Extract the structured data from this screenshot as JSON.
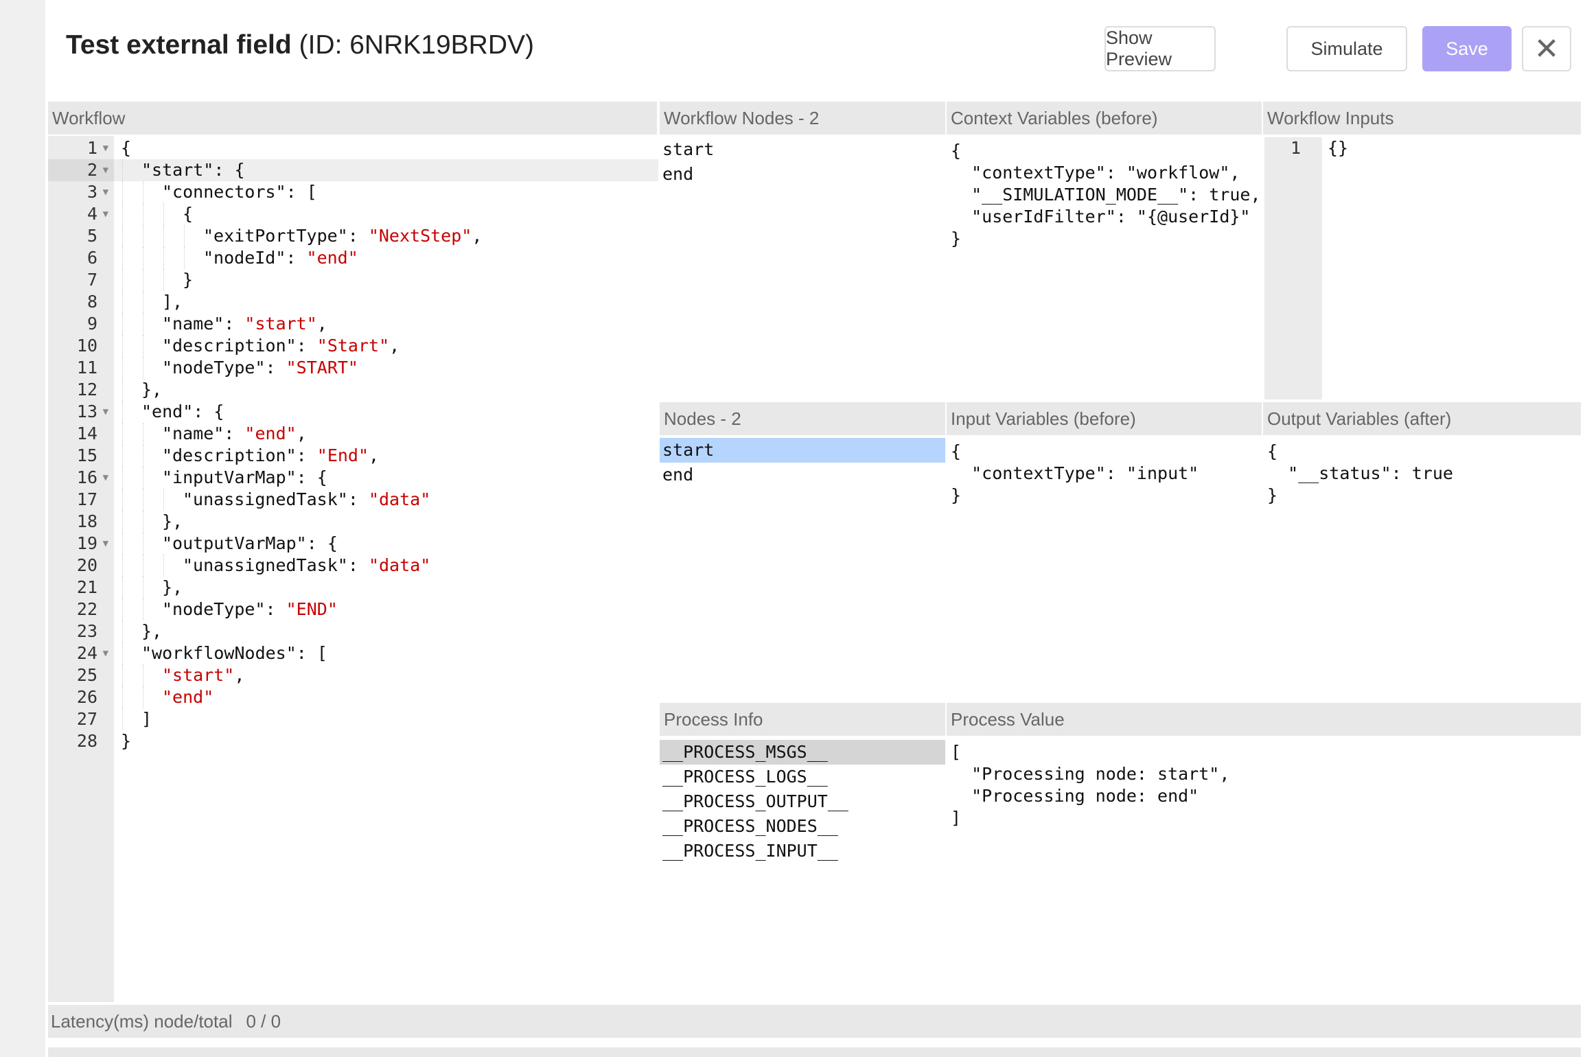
{
  "header": {
    "title_bold": "Test external field",
    "title_id": "(ID: 6NRK19BRDV)",
    "buttons": {
      "show_preview": "Show Preview",
      "simulate": "Simulate",
      "save": "Save",
      "close": "✕"
    }
  },
  "workflow": {
    "label": "Workflow",
    "lines": [
      {
        "n": "1",
        "fold": true,
        "indent": 0,
        "parts": [
          {
            "t": "{"
          }
        ]
      },
      {
        "n": "2",
        "fold": true,
        "indent": 1,
        "parts": [
          {
            "t": "\"start\": {"
          }
        ]
      },
      {
        "n": "3",
        "fold": true,
        "indent": 2,
        "parts": [
          {
            "t": "\"connectors\": ["
          }
        ]
      },
      {
        "n": "4",
        "fold": true,
        "indent": 3,
        "parts": [
          {
            "t": "{"
          }
        ]
      },
      {
        "n": "5",
        "fold": false,
        "indent": 4,
        "parts": [
          {
            "t": "\"exitPortType\": "
          },
          {
            "t": "\"NextStep\"",
            "s": true
          },
          {
            "t": ","
          }
        ]
      },
      {
        "n": "6",
        "fold": false,
        "indent": 4,
        "parts": [
          {
            "t": "\"nodeId\": "
          },
          {
            "t": "\"end\"",
            "s": true
          }
        ]
      },
      {
        "n": "7",
        "fold": false,
        "indent": 3,
        "parts": [
          {
            "t": "}"
          }
        ]
      },
      {
        "n": "8",
        "fold": false,
        "indent": 2,
        "parts": [
          {
            "t": "],"
          }
        ]
      },
      {
        "n": "9",
        "fold": false,
        "indent": 2,
        "parts": [
          {
            "t": "\"name\": "
          },
          {
            "t": "\"start\"",
            "s": true
          },
          {
            "t": ","
          }
        ]
      },
      {
        "n": "10",
        "fold": false,
        "indent": 2,
        "parts": [
          {
            "t": "\"description\": "
          },
          {
            "t": "\"Start\"",
            "s": true
          },
          {
            "t": ","
          }
        ]
      },
      {
        "n": "11",
        "fold": false,
        "indent": 2,
        "parts": [
          {
            "t": "\"nodeType\": "
          },
          {
            "t": "\"START\"",
            "s": true
          }
        ]
      },
      {
        "n": "12",
        "fold": false,
        "indent": 1,
        "parts": [
          {
            "t": "},"
          }
        ]
      },
      {
        "n": "13",
        "fold": true,
        "indent": 1,
        "parts": [
          {
            "t": "\"end\": {"
          }
        ]
      },
      {
        "n": "14",
        "fold": false,
        "indent": 2,
        "parts": [
          {
            "t": "\"name\": "
          },
          {
            "t": "\"end\"",
            "s": true
          },
          {
            "t": ","
          }
        ]
      },
      {
        "n": "15",
        "fold": false,
        "indent": 2,
        "parts": [
          {
            "t": "\"description\": "
          },
          {
            "t": "\"End\"",
            "s": true
          },
          {
            "t": ","
          }
        ]
      },
      {
        "n": "16",
        "fold": true,
        "indent": 2,
        "parts": [
          {
            "t": "\"inputVarMap\": {"
          }
        ]
      },
      {
        "n": "17",
        "fold": false,
        "indent": 3,
        "parts": [
          {
            "t": "\"unassignedTask\": "
          },
          {
            "t": "\"data\"",
            "s": true
          }
        ]
      },
      {
        "n": "18",
        "fold": false,
        "indent": 2,
        "parts": [
          {
            "t": "},"
          }
        ]
      },
      {
        "n": "19",
        "fold": true,
        "indent": 2,
        "parts": [
          {
            "t": "\"outputVarMap\": {"
          }
        ]
      },
      {
        "n": "20",
        "fold": false,
        "indent": 3,
        "parts": [
          {
            "t": "\"unassignedTask\": "
          },
          {
            "t": "\"data\"",
            "s": true
          }
        ]
      },
      {
        "n": "21",
        "fold": false,
        "indent": 2,
        "parts": [
          {
            "t": "},"
          }
        ]
      },
      {
        "n": "22",
        "fold": false,
        "indent": 2,
        "parts": [
          {
            "t": "\"nodeType\": "
          },
          {
            "t": "\"END\"",
            "s": true
          }
        ]
      },
      {
        "n": "23",
        "fold": false,
        "indent": 1,
        "parts": [
          {
            "t": "},"
          }
        ]
      },
      {
        "n": "24",
        "fold": true,
        "indent": 1,
        "parts": [
          {
            "t": "\"workflowNodes\": ["
          }
        ]
      },
      {
        "n": "25",
        "fold": false,
        "indent": 2,
        "parts": [
          {
            "t": "\"start\"",
            "s": true
          },
          {
            "t": ","
          }
        ]
      },
      {
        "n": "26",
        "fold": false,
        "indent": 2,
        "parts": [
          {
            "t": "\"end\"",
            "s": true
          }
        ]
      },
      {
        "n": "27",
        "fold": false,
        "indent": 1,
        "parts": [
          {
            "t": "]"
          }
        ]
      },
      {
        "n": "28",
        "fold": false,
        "indent": 0,
        "parts": [
          {
            "t": "}"
          }
        ]
      }
    ]
  },
  "workflow_nodes": {
    "label": "Workflow Nodes - 2",
    "items": [
      "start",
      "end"
    ]
  },
  "context_vars": {
    "label": "Context Variables (before)",
    "text": "{\n  \"contextType\": \"workflow\",\n  \"__SIMULATION_MODE__\": true,\n  \"userIdFilter\": \"{@userId}\"\n}"
  },
  "workflow_inputs": {
    "label": "Workflow Inputs",
    "line_number": "1",
    "text": "{}"
  },
  "nodes": {
    "label": "Nodes - 2",
    "items": [
      "start",
      "end"
    ],
    "selected": "start"
  },
  "input_vars": {
    "label": "Input Variables (before)",
    "text": "{\n  \"contextType\": \"input\"\n}"
  },
  "output_vars": {
    "label": "Output Variables (after)",
    "text": "{\n  \"__status\": true\n}"
  },
  "process_info": {
    "label": "Process Info",
    "items": [
      "__PROCESS_MSGS__",
      "__PROCESS_LOGS__",
      "__PROCESS_OUTPUT__",
      "__PROCESS_NODES__",
      "__PROCESS_INPUT__"
    ],
    "selected": "__PROCESS_MSGS__"
  },
  "process_value": {
    "label": "Process Value",
    "text": "[\n  \"Processing node: start\",\n  \"Processing node: end\"\n]"
  },
  "footer": {
    "latency_label": "Latency(ms) node/total",
    "latency_value": "0 / 0"
  },
  "colors": {
    "save_bg": "#aba2f5",
    "string": "#c80000",
    "node_selected": "#b5d5ff",
    "process_selected": "#d5d5d5"
  }
}
